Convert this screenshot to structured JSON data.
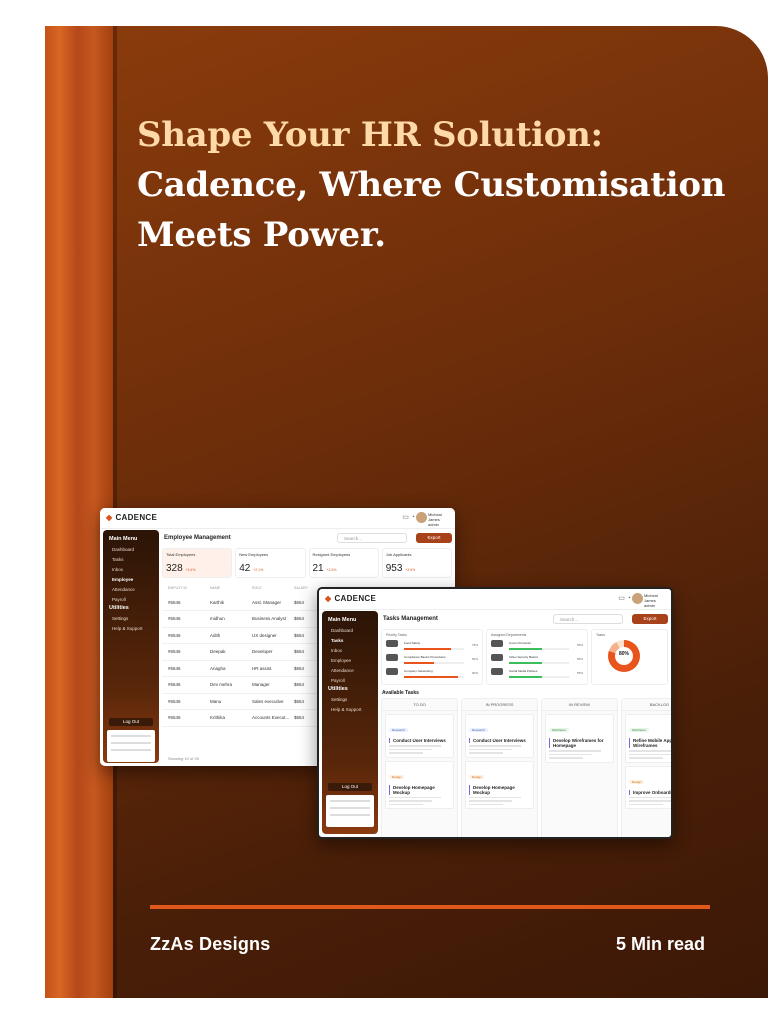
{
  "cover": {
    "title_line1": "Shape Your HR Solution:",
    "title_line2": "Cadence, Where Customisation",
    "title_line3": "Meets Power.",
    "brand": "ZzAs Designs",
    "read_time": "5 Min read",
    "colors": {
      "accent": "#e0581c",
      "highlight": "#ffd9a8",
      "background": "#6e2e0a"
    }
  },
  "app": {
    "logo": "CADENCE",
    "user_name": "Micheal James",
    "user_role": "admin",
    "main_menu": "Main Menu",
    "utilities": "Utilities",
    "logout": "Log Out",
    "export": "Export",
    "search_placeholder": "Search...",
    "menu": [
      "Dashboard",
      "Tasks",
      "Inbox",
      "Employee",
      "Attendance",
      "Payroll"
    ],
    "util_menu": [
      "Settings",
      "Help & Support"
    ]
  },
  "employee_screen": {
    "title": "Employee Management",
    "cards": [
      {
        "label": "Total Employees",
        "value": "328",
        "badge": "+3.4%"
      },
      {
        "label": "New Employees",
        "value": "42",
        "badge": "+2.1%"
      },
      {
        "label": "Resigned Employees",
        "value": "21",
        "badge": "+2.4%"
      },
      {
        "label": "Job Applicants",
        "value": "953",
        "badge": "+3.5%"
      }
    ],
    "columns": [
      "EMPLOY ID",
      "NAME",
      "ROLE",
      "SALARY"
    ],
    "rows": [
      {
        "id": "#6546",
        "name": "Karthik",
        "role": "Asst. Manager",
        "salary": "$654"
      },
      {
        "id": "#6546",
        "name": "midhun",
        "role": "Business Analyst",
        "salary": "$654"
      },
      {
        "id": "#6546",
        "name": "Adith",
        "role": "UX designer",
        "salary": "$654"
      },
      {
        "id": "#6546",
        "name": "Deepak",
        "role": "Developer",
        "salary": "$654"
      },
      {
        "id": "#6546",
        "name": "Anagha",
        "role": "HR assist.",
        "salary": "$654"
      },
      {
        "id": "#6546",
        "name": "Dev mehra",
        "role": "Manager",
        "salary": "$654"
      },
      {
        "id": "#6546",
        "name": "Manu",
        "role": "Sales executive",
        "salary": "$654"
      },
      {
        "id": "#6546",
        "name": "Krithika",
        "role": "Accounts Execut...",
        "salary": "$654"
      }
    ],
    "footer": "Showing 10 of 20"
  },
  "tasks_screen": {
    "title": "Tasks Management",
    "priority_label": "Priority Tasks",
    "assigned_label": "Assigned Departments",
    "tasks_label": "Tasks",
    "donut_value": "80%",
    "donut_fraction": 0.8,
    "priority": [
      {
        "name": "Food Safety",
        "pct": "78%",
        "value": 0.78
      },
      {
        "name": "Compliance Basics Procedures",
        "pct": "50%",
        "value": 0.5
      },
      {
        "name": "Company Networking",
        "pct": "90%",
        "value": 0.9
      }
    ],
    "assigned": [
      {
        "name": "Cusco Protocols",
        "pct": "55%",
        "value": 0.55
      },
      {
        "name": "Video Security Basics",
        "pct": "55%",
        "value": 0.55
      },
      {
        "name": "Social Media Policies",
        "pct": "55%",
        "value": 0.55
      }
    ],
    "available_label": "Available Tasks",
    "columns": [
      {
        "name": "TO DO",
        "tasks": [
          {
            "tag": "Research",
            "title": "Conduct User Interviews"
          },
          {
            "tag": "Design",
            "title": "Develop Homepage Mockup"
          }
        ]
      },
      {
        "name": "IN PROGRESS",
        "tasks": [
          {
            "tag": "Research",
            "title": "Conduct User Interviews"
          },
          {
            "tag": "Design",
            "title": "Develop Homepage Mockup"
          }
        ]
      },
      {
        "name": "IN REVIEW",
        "tasks": [
          {
            "tag": "Wireframe",
            "title": "Develop Wireframes for Homepage"
          }
        ]
      },
      {
        "name": "BACKLOG",
        "tasks": [
          {
            "tag": "Wireframe",
            "title": "Refine Mobile App Wireframes"
          },
          {
            "tag": "Design",
            "title": "Improve Onboarding"
          }
        ]
      }
    ]
  }
}
